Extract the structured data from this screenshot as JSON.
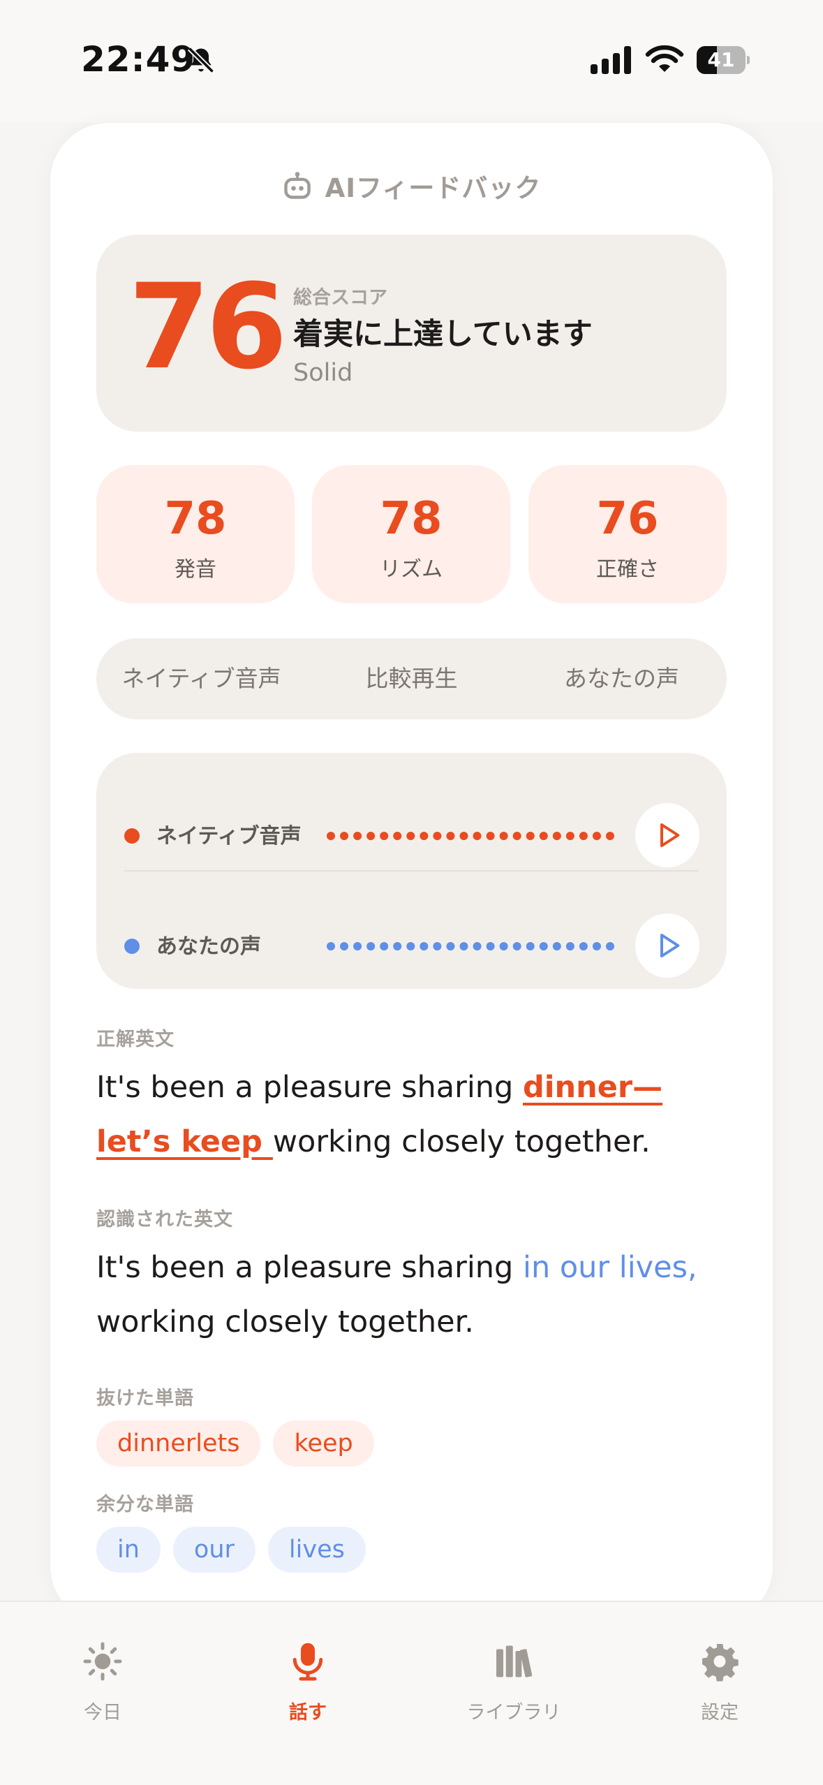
{
  "status": {
    "time": "22:49",
    "battery": "41",
    "battery_level": 0.41
  },
  "card": {
    "title": "AIフィードバック",
    "score": {
      "value": "76",
      "label": "総合スコア",
      "message": "着実に上達しています",
      "sub": "Solid"
    },
    "metrics": [
      {
        "value": "78",
        "label": "発音"
      },
      {
        "value": "78",
        "label": "リズム"
      },
      {
        "value": "76",
        "label": "正確さ"
      }
    ],
    "segments": [
      "ネイティブ音声",
      "比較再生",
      "あなたの声"
    ],
    "player": [
      {
        "label": "ネイティブ音声",
        "color": "#e94c1f"
      },
      {
        "label": "あなたの声",
        "color": "#5f8fe6"
      }
    ],
    "correct": {
      "label": "正解英文",
      "before": "It's been a pleasure sharing ",
      "highlight": "dinner—let’s keep ",
      "after": "working closely together."
    },
    "recognized": {
      "label": "認識された英文",
      "before": "It's been a pleasure sharing ",
      "highlight": "in our lives,",
      "after": " working closely together."
    },
    "missing": {
      "label": "抜けた単語",
      "words": [
        "dinnerlets",
        "keep"
      ]
    },
    "extra": {
      "label": "余分な単語",
      "words": [
        "in",
        "our",
        "lives"
      ]
    }
  },
  "tabs": [
    {
      "label": "今日",
      "icon": "sun-icon"
    },
    {
      "label": "話す",
      "icon": "microphone-icon",
      "active": true
    },
    {
      "label": "ライブラリ",
      "icon": "library-icon"
    },
    {
      "label": "設定",
      "icon": "gear-icon"
    }
  ],
  "colors": {
    "accent": "#e94c1f",
    "blue": "#5f8fe6",
    "muted": "#a19b96"
  }
}
